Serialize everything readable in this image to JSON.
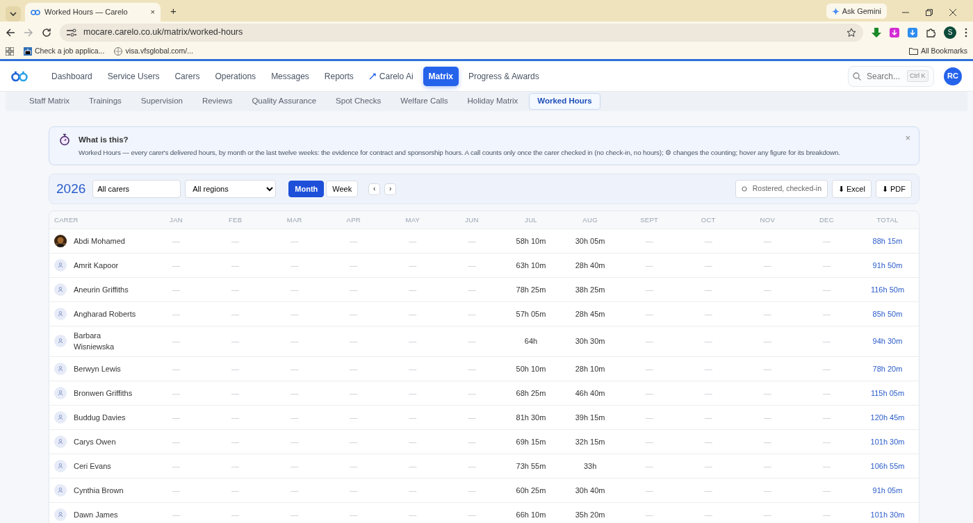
{
  "browser": {
    "tab_title": "Worked Hours — Carelo",
    "tab_close": "×",
    "new_tab": "+",
    "ask_gemini": "Ask Gemini",
    "address": "mocare.carelo.co.uk/matrix/worked-hours",
    "profile_initial": "S",
    "bookmarks": [
      {
        "label": "Check a job applica..."
      },
      {
        "label": "visa.vfsglobal.com/..."
      }
    ],
    "all_bookmarks": "All Bookmarks"
  },
  "nav": {
    "items": [
      {
        "label": "Dashboard",
        "selected": false
      },
      {
        "label": "Service Users",
        "selected": false
      },
      {
        "label": "Carers",
        "selected": false
      },
      {
        "label": "Operations",
        "selected": false
      },
      {
        "label": "Messages",
        "selected": false
      },
      {
        "label": "Reports",
        "selected": false
      },
      {
        "label": "Carelo Ai",
        "selected": false,
        "kind": "ai"
      },
      {
        "label": "Matrix",
        "selected": true
      },
      {
        "label": "Progress & Awards",
        "selected": false
      }
    ],
    "search": {
      "placeholder": "Search...",
      "shortcut": "Ctrl K"
    },
    "avatar": "RC"
  },
  "subtabs": [
    {
      "label": "Staff Matrix",
      "selected": false
    },
    {
      "label": "Trainings",
      "selected": false
    },
    {
      "label": "Supervision",
      "selected": false
    },
    {
      "label": "Reviews",
      "selected": false
    },
    {
      "label": "Quality Assurance",
      "selected": false
    },
    {
      "label": "Spot Checks",
      "selected": false
    },
    {
      "label": "Welfare Calls",
      "selected": false
    },
    {
      "label": "Holiday Matrix",
      "selected": false
    },
    {
      "label": "Worked Hours",
      "selected": true
    }
  ],
  "info": {
    "title": "What is this?",
    "text": "Worked Hours — every carer's delivered hours, by month or the last twelve weeks: the evidence for contract and sponsorship hours. A call counts only once the carer checked in (no check-in, no hours); ⚙ changes the counting; hover any figure for its breakdown.",
    "close": "×"
  },
  "toolbar": {
    "year": "2026",
    "carer_filter": "All carers",
    "region_filter": "All regions",
    "views": [
      {
        "label": "Month",
        "selected": true
      },
      {
        "label": "Week",
        "selected": false
      }
    ],
    "prev": "‹",
    "next": "›",
    "counting": "Rostered, checked-in",
    "exports": [
      "⬇ Excel",
      "⬇ PDF"
    ]
  },
  "table": {
    "columns": [
      "CARER",
      "JAN",
      "FEB",
      "MAR",
      "APR",
      "MAY",
      "JUN",
      "JUL",
      "AUG",
      "SEPT",
      "OCT",
      "NOV",
      "DEC",
      "TOTAL"
    ],
    "rows": [
      {
        "name": "Abdi Mohamed",
        "months": [
          "—",
          "—",
          "—",
          "—",
          "—",
          "—",
          "58h 10m",
          "30h 05m",
          "—",
          "—",
          "—",
          "—"
        ],
        "total": "88h 15m"
      },
      {
        "name": "Amrit Kapoor",
        "kind": "generic",
        "months": [
          "—",
          "—",
          "—",
          "—",
          "—",
          "—",
          "63h 10m",
          "28h 40m",
          "—",
          "—",
          "—",
          "—"
        ],
        "total": "91h 50m"
      },
      {
        "name": "Aneurin Griffiths",
        "kind": "generic",
        "months": [
          "—",
          "—",
          "—",
          "—",
          "—",
          "—",
          "78h 25m",
          "38h 25m",
          "—",
          "—",
          "—",
          "—"
        ],
        "total": "116h 50m"
      },
      {
        "name": "Angharad Roberts",
        "kind": "generic",
        "months": [
          "—",
          "—",
          "—",
          "—",
          "—",
          "—",
          "57h 05m",
          "28h 45m",
          "—",
          "—",
          "—",
          "—"
        ],
        "total": "85h 50m"
      },
      {
        "name": "Barbara Wisniewska",
        "kind": "generic",
        "months": [
          "—",
          "—",
          "—",
          "—",
          "—",
          "—",
          "64h",
          "30h 30m",
          "—",
          "—",
          "—",
          "—"
        ],
        "total": "94h 30m"
      },
      {
        "name": "Berwyn Lewis",
        "kind": "generic",
        "months": [
          "—",
          "—",
          "—",
          "—",
          "—",
          "—",
          "50h 10m",
          "28h 10m",
          "—",
          "—",
          "—",
          "—"
        ],
        "total": "78h 20m"
      },
      {
        "name": "Bronwen Griffiths",
        "kind": "generic",
        "months": [
          "—",
          "—",
          "—",
          "—",
          "—",
          "—",
          "68h 25m",
          "46h 40m",
          "—",
          "—",
          "—",
          "—"
        ],
        "total": "115h 05m"
      },
      {
        "name": "Buddug Davies",
        "kind": "generic",
        "months": [
          "—",
          "—",
          "—",
          "—",
          "—",
          "—",
          "81h 30m",
          "39h 15m",
          "—",
          "—",
          "—",
          "—"
        ],
        "total": "120h 45m"
      },
      {
        "name": "Carys Owen",
        "kind": "generic",
        "months": [
          "—",
          "—",
          "—",
          "—",
          "—",
          "—",
          "69h 15m",
          "32h 15m",
          "—",
          "—",
          "—",
          "—"
        ],
        "total": "101h 30m"
      },
      {
        "name": "Ceri Evans",
        "kind": "generic",
        "months": [
          "—",
          "—",
          "—",
          "—",
          "—",
          "—",
          "73h 55m",
          "33h",
          "—",
          "—",
          "—",
          "—"
        ],
        "total": "106h 55m"
      },
      {
        "name": "Cynthia Brown",
        "kind": "generic",
        "months": [
          "—",
          "—",
          "—",
          "—",
          "—",
          "—",
          "60h 25m",
          "30h 40m",
          "—",
          "—",
          "—",
          "—"
        ],
        "total": "91h 05m"
      },
      {
        "name": "Dawn James",
        "kind": "generic",
        "months": [
          "—",
          "—",
          "—",
          "—",
          "—",
          "—",
          "66h 10m",
          "35h 20m",
          "—",
          "—",
          "—",
          "—"
        ],
        "total": "101h 30m"
      }
    ]
  }
}
